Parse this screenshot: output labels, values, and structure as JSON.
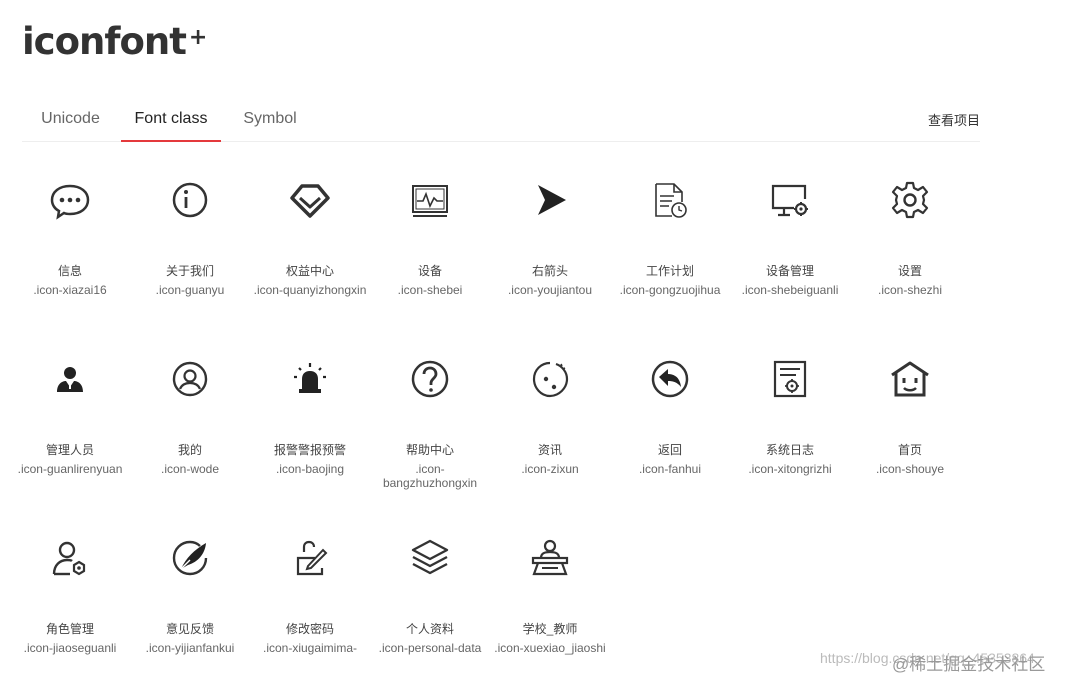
{
  "logo": {
    "text": "iconfont",
    "plus": "+"
  },
  "tabs": [
    {
      "label": "Unicode"
    },
    {
      "label": "Font class"
    },
    {
      "label": "Symbol"
    }
  ],
  "view_project": "查看项目",
  "icons": [
    {
      "name": "信息",
      "code": ".icon-xiazai16"
    },
    {
      "name": "关于我们",
      "code": ".icon-guanyu"
    },
    {
      "name": "权益中心",
      "code": ".icon-quanyizhongxin"
    },
    {
      "name": "设备",
      "code": ".icon-shebei"
    },
    {
      "name": "右箭头",
      "code": ".icon-youjiantou"
    },
    {
      "name": "工作计划",
      "code": ".icon-gongzuojihua"
    },
    {
      "name": "设备管理",
      "code": ".icon-shebeiguanli"
    },
    {
      "name": "设置",
      "code": ".icon-shezhi"
    },
    {
      "name": "管理人员",
      "code": ".icon-guanlirenyuan"
    },
    {
      "name": "我的",
      "code": ".icon-wode"
    },
    {
      "name": "报警警报预警",
      "code": ".icon-baojing"
    },
    {
      "name": "帮助中心",
      "code": ".icon-bangzhuzhongxin"
    },
    {
      "name": "资讯",
      "code": ".icon-zixun"
    },
    {
      "name": "返回",
      "code": ".icon-fanhui"
    },
    {
      "name": "系统日志",
      "code": ".icon-xitongrizhi"
    },
    {
      "name": "首页",
      "code": ".icon-shouye"
    },
    {
      "name": "角色管理",
      "code": ".icon-jiaoseguanli"
    },
    {
      "name": "意见反馈",
      "code": ".icon-yijianfankui"
    },
    {
      "name": "修改密码",
      "code": ".icon-xiugaimima-"
    },
    {
      "name": "个人资料",
      "code": ".icon-personal-data"
    },
    {
      "name": "学校_教师",
      "code": ".icon-xuexiao_jiaoshi"
    }
  ],
  "watermark": {
    "main": "@稀土掘金技术社区",
    "url": "https://blog.csdn.net/qq_45353864"
  }
}
